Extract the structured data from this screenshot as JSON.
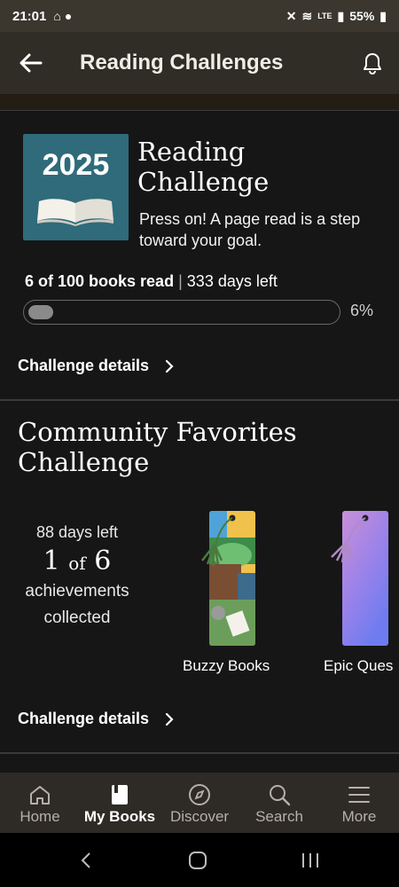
{
  "status": {
    "time": "21:01",
    "battery": "55%",
    "net": "LTE"
  },
  "appbar": {
    "title": "Reading Challenges"
  },
  "reading_challenge": {
    "badge_year": "2025",
    "title_line1": "Reading",
    "title_line2": "Challenge",
    "subtitle": "Press on! A page read is a step toward your goal.",
    "books_read_text": "6 of 100 books read",
    "separator": "|",
    "days_left_text": "333 days left",
    "progress_fraction": 0.06,
    "percent_text": "6%",
    "details_label": "Challenge details"
  },
  "community": {
    "title": "Community Favorites Challenge",
    "days_left": "88 days left",
    "collected": "1",
    "of_label": "of",
    "total": "6",
    "achievements_line1": "achievements",
    "achievements_line2": "collected",
    "bookmarks": [
      {
        "label": "Buzzy Books"
      },
      {
        "label": "Epic Ques"
      }
    ],
    "details_label": "Challenge details"
  },
  "nav": {
    "items": [
      {
        "label": "Home"
      },
      {
        "label": "My Books"
      },
      {
        "label": "Discover"
      },
      {
        "label": "Search"
      },
      {
        "label": "More"
      }
    ]
  },
  "colors": {
    "accent": "#2f6b7a",
    "background": "#161616",
    "appbar": "#302c26"
  }
}
